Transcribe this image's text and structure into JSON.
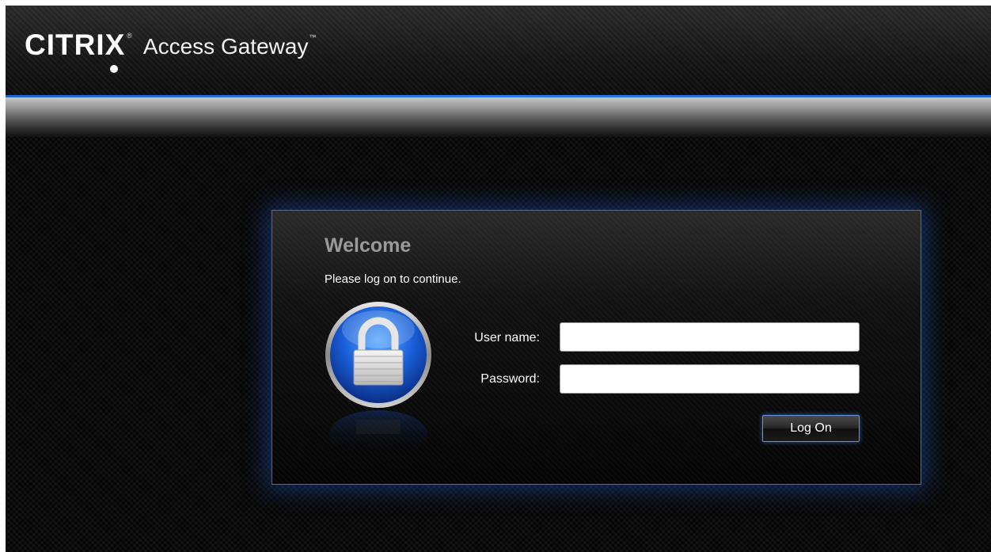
{
  "header": {
    "brand": "CITRIX",
    "registered_mark": "®",
    "product": "Access Gateway",
    "trademark": "™"
  },
  "login": {
    "title": "Welcome",
    "subtitle": "Please log on to continue.",
    "username_label": "User name:",
    "username_value": "",
    "password_label": "Password:",
    "password_value": "",
    "submit_label": "Log On"
  },
  "icons": {
    "lock": "padlock-icon"
  },
  "colors": {
    "accent_blue": "#2a78ef",
    "page_background": "#050505",
    "welcome_gray": "#9a9a9a"
  }
}
